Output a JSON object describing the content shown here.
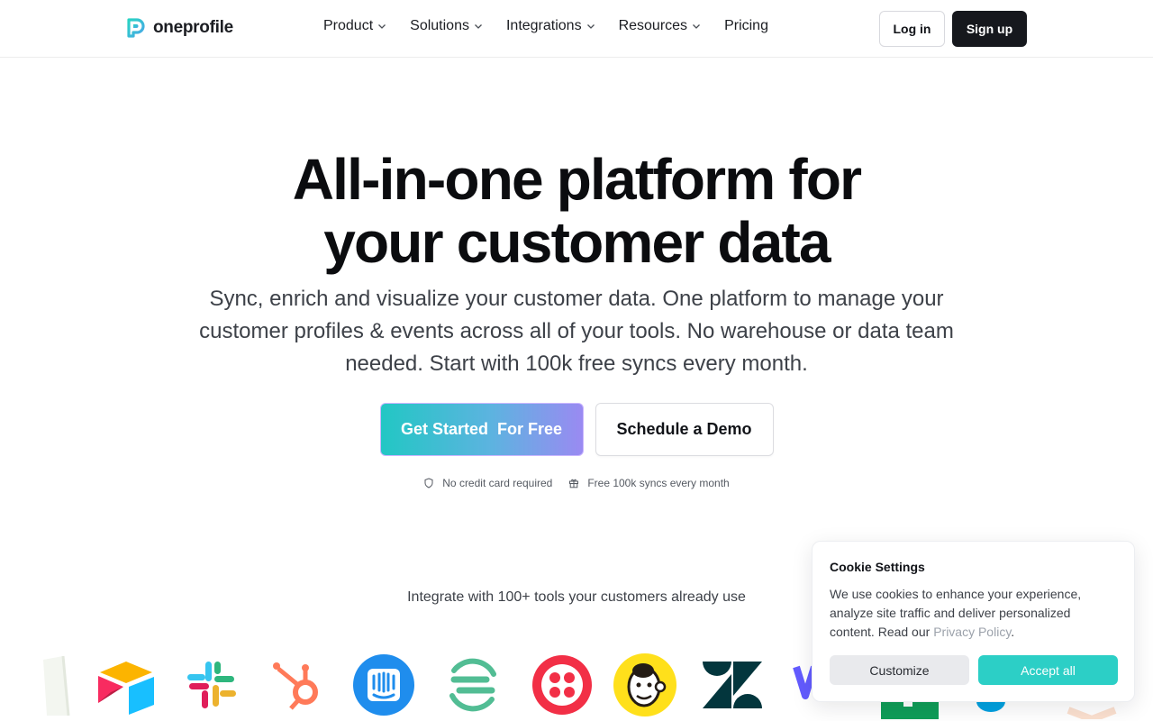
{
  "brand": {
    "name": "oneprofile",
    "accent": "#2ccfc6",
    "dark": "#16181d"
  },
  "nav": {
    "items": [
      {
        "label": "Product",
        "has_menu": true
      },
      {
        "label": "Solutions",
        "has_menu": true
      },
      {
        "label": "Integrations",
        "has_menu": true
      },
      {
        "label": "Resources",
        "has_menu": true
      },
      {
        "label": "Pricing",
        "has_menu": false
      }
    ],
    "login_label": "Log in",
    "signup_label": "Sign up"
  },
  "hero": {
    "title_line1": "All-in-one platform for",
    "title_line2": "your customer data",
    "subtitle": "Sync, enrich and visualize your customer data. One platform to manage your customer profiles & events across all of your tools. No warehouse or data team needed. Start with 100k free syncs every month.",
    "primary_cta": "Get Started  For Free",
    "secondary_cta": "Schedule a Demo",
    "perks": [
      {
        "icon": "shield-icon",
        "label": "No credit card required"
      },
      {
        "icon": "gift-icon",
        "label": "Free 100k syncs every month"
      }
    ]
  },
  "integrations": {
    "heading": "Integrate with 100+ tools your customers already use",
    "logos": [
      "shopify-logo",
      "airtable-logo",
      "slack-logo",
      "hubspot-logo",
      "intercom-logo",
      "segment-logo",
      "twilio-logo",
      "mailchimp-logo",
      "zendesk-logo",
      "stripe-logo",
      "google-sheets-logo",
      "salesforce-logo",
      "brevo-logo"
    ]
  },
  "cookie": {
    "title": "Cookie Settings",
    "text": "We use cookies to enhance your experience, analyze site traffic and deliver personalized content. Read our ",
    "link_label": "Privacy Policy",
    "text_end": ".",
    "customize_label": "Customize",
    "accept_label": "Accept all"
  }
}
